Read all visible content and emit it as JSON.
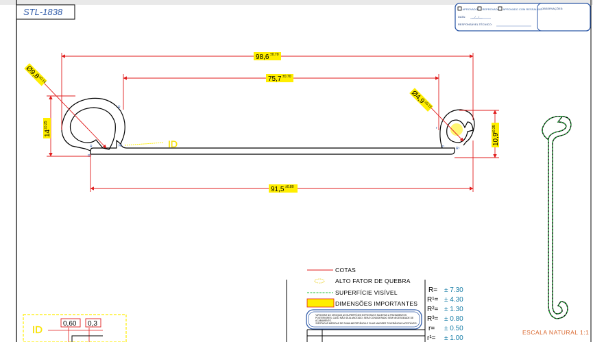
{
  "drawing": {
    "code": "STL-1838",
    "scale": "ESCALA NATURAL 1:1"
  },
  "title_block": {
    "approved": "APROVADO",
    "reproved": "REPROVADO",
    "approved_with_reservation": "APROVADO COM RESSALVAS",
    "date_label": "DATA:",
    "date_value": "__/__/__",
    "responsible_label": "RESPONSÁVEL TÉCNICO:",
    "observations_label": "OBSERVAÇÕES:"
  },
  "dimensions": {
    "overall_width": "98,6",
    "overall_width_tol": "±0.70",
    "inner_width": "75,7",
    "inner_width_tol": "±0.70",
    "bottom_width": "91,5",
    "bottom_width_tol": "±0.80",
    "left_diameter": "Ø9,8",
    "left_diameter_tol": "±0.15",
    "left_height": "14",
    "left_height_tol": "±0.25",
    "right_diameter": "Ø4,9",
    "right_diameter_tol": "±0.15",
    "right_height": "10,9",
    "right_height_tol": "±0.35",
    "id_label": "ID",
    "r_label": "R",
    "r1_label": "R¹",
    "r2_label": "R²",
    "r3_label": "R³",
    "r_small_label": "r",
    "r1_small_label": "r¹"
  },
  "legend": {
    "dimensions": "COTAS",
    "high_break_factor": "ALTO FATOR DE QUEBRA",
    "visible_surface": "SUPERFÍCIE VISÍVEL",
    "important_dimensions": "DIMENSÕES IMPORTANTES"
  },
  "note": {
    "line1": "*APONTAR NO CROQUIS AS SUPERFÍCIES EXPOSTAS E SUJEITAS A TRATAMENTOS",
    "line2": "POSTERIORES, CASO NÃO SEJA ANOTADO, SERÁ CONSIDERADO SEM NECESSIDADE DE",
    "line3": "ACABAMENTO.",
    "line4": "*DESTACAR MEDIDAS DE SUMA IMPORTÂNCIA E SUAS MAIORES TOLERÂNCIAS ACEITÁVEIS."
  },
  "radii": [
    {
      "label": "R=",
      "value": "± 7.30"
    },
    {
      "label": "R¹=",
      "value": "± 4.30"
    },
    {
      "label": "R²=",
      "value": "± 1.30"
    },
    {
      "label": "R³=",
      "value": "± 0.80"
    },
    {
      "label": "r=",
      "value": "± 0.50"
    },
    {
      "label": "r¹=",
      "value": "± 1.00"
    }
  ],
  "detail": {
    "id_label": "ID",
    "dim_a": "0,60",
    "dim_b": "0,3"
  },
  "colors": {
    "dimension_line": "#e01b1b",
    "important_fill": "#ffee00",
    "visible_surface": "#1fbf3a",
    "title_border": "#2f5aa8",
    "radius_value": "#1a7fa8"
  }
}
